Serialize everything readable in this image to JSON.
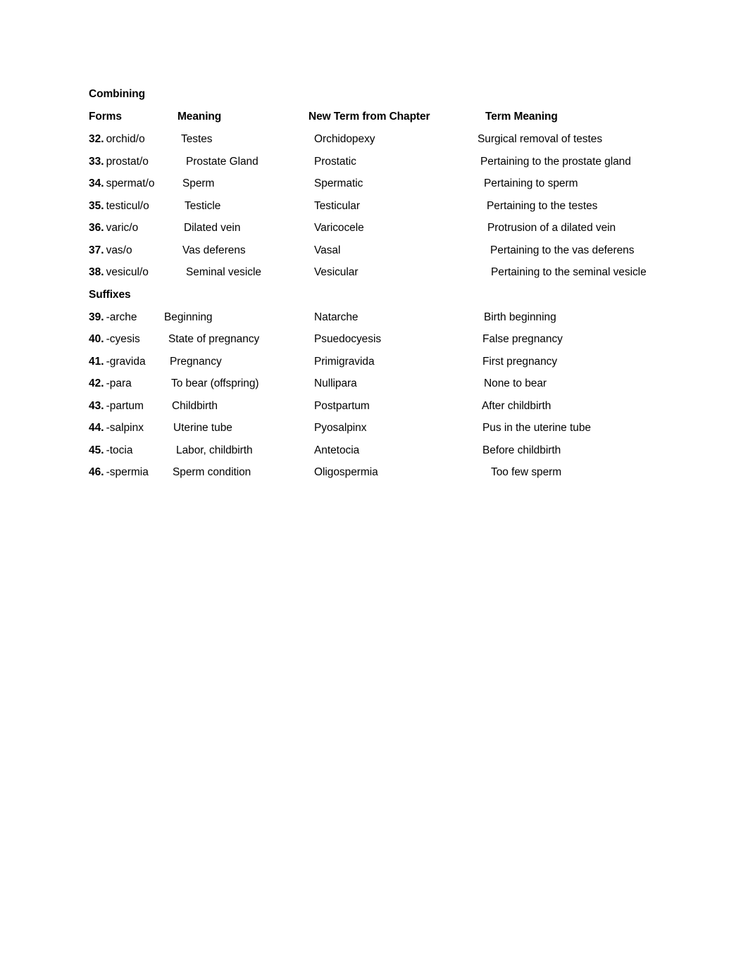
{
  "document": {
    "sections": [
      {
        "id": "combining-forms",
        "title_line1": "Combining",
        "headers": {
          "col1": "Forms",
          "col2": "Meaning",
          "col3": "New Term from Chapter",
          "col4": "Term Meaning"
        },
        "rows": [
          {
            "number": "32.",
            "term": "orchid/o",
            "meaning": "Testes",
            "new_term": "Orchidopexy",
            "term_meaning": "Surgical removal of testes",
            "meaning_indent": 131,
            "term_meaning_indent": 552
          },
          {
            "number": "33.",
            "term": "prostat/o",
            "meaning": "Prostate Gland",
            "new_term": "Prostatic",
            "term_meaning": "Pertaining to the prostate gland",
            "meaning_indent": 138,
            "term_meaning_indent": 556
          },
          {
            "number": "34.",
            "term": "spermat/o",
            "meaning": "Sperm",
            "new_term": "Spermatic",
            "term_meaning": "Pertaining to sperm",
            "meaning_indent": 133,
            "term_meaning_indent": 561
          },
          {
            "number": "35.",
            "term": "testicul/o",
            "meaning": "Testicle",
            "new_term": "Testicular",
            "term_meaning": "Pertaining to the testes",
            "meaning_indent": 136,
            "term_meaning_indent": 565
          },
          {
            "number": "36.",
            "term": "varic/o",
            "meaning": "Dilated vein",
            "new_term": "Varicocele",
            "term_meaning": "Protrusion of a dilated vein",
            "meaning_indent": 135,
            "term_meaning_indent": 566
          },
          {
            "number": "37.",
            "term": "vas/o",
            "meaning": "Vas deferens",
            "new_term": "Vasal",
            "term_meaning": "Pertaining to the vas deferens",
            "meaning_indent": 133,
            "term_meaning_indent": 570
          },
          {
            "number": "38.",
            "term": "vesicul/o",
            "meaning": "Seminal vesicle",
            "new_term": "Vesicular",
            "term_meaning": "Pertaining to the seminal vesicle",
            "meaning_indent": 138,
            "term_meaning_indent": 571
          }
        ]
      },
      {
        "id": "suffixes",
        "title_line1": "Suffixes",
        "rows": [
          {
            "number": "39.",
            "term": "-arche",
            "meaning": "Beginning",
            "new_term": "Natarche",
            "term_meaning": "Birth beginning",
            "meaning_indent": 107,
            "term_meaning_indent": 561
          },
          {
            "number": "40.",
            "term": "-cyesis",
            "meaning": "State of pregnancy",
            "new_term": "Psuedocyesis",
            "term_meaning": "False pregnancy",
            "meaning_indent": 113,
            "term_meaning_indent": 559
          },
          {
            "number": "41.",
            "term": "-gravida",
            "meaning": "Pregnancy",
            "new_term": "Primigravida",
            "term_meaning": "First pregnancy",
            "meaning_indent": 115,
            "term_meaning_indent": 559
          },
          {
            "number": "42.",
            "term": "-para",
            "meaning": "To bear (offspring)",
            "new_term": "Nullipara",
            "term_meaning": "None to bear",
            "meaning_indent": 117,
            "term_meaning_indent": 561
          },
          {
            "number": "43.",
            "term": "-partum",
            "meaning": "Childbirth",
            "new_term": "Postpartum",
            "term_meaning": "After childbirth",
            "meaning_indent": 118,
            "term_meaning_indent": 558
          },
          {
            "number": "44.",
            "term": "-salpinx",
            "meaning": "Uterine tube",
            "new_term": "Pyosalpinx",
            "term_meaning": "Pus in the uterine tube",
            "meaning_indent": 120,
            "term_meaning_indent": 559
          },
          {
            "number": "45.",
            "term": "-tocia",
            "meaning": "Labor, childbirth",
            "new_term": "Antetocia",
            "term_meaning": "Before childbirth",
            "meaning_indent": 124,
            "term_meaning_indent": 559
          },
          {
            "number": "46.",
            "term": "-spermia",
            "meaning": "Sperm condition",
            "new_term": "Oligospermia",
            "term_meaning": "Too few sperm",
            "meaning_indent": 119,
            "term_meaning_indent": 571
          }
        ]
      }
    ]
  }
}
